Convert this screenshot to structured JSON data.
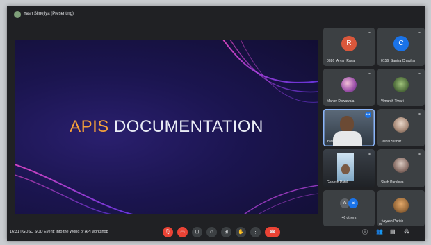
{
  "header": {
    "presenting_label": "Yash Simejiya (Presenting)"
  },
  "slide": {
    "title_part1": "APIS",
    "title_part2": "DOCUMENTATION"
  },
  "participants": [
    {
      "name": "0026_Aryan Raval",
      "initial": "R",
      "avatar_color": "#d9573b",
      "type": "initial"
    },
    {
      "name": "0156_Saniya Chauhan",
      "initial": "C",
      "avatar_color": "#1a73e8",
      "type": "initial"
    },
    {
      "name": "Manav Dawawala",
      "type": "photo"
    },
    {
      "name": "Vimarsh Tiwari",
      "type": "photo"
    },
    {
      "name": "Yash Simejiya",
      "type": "video"
    },
    {
      "name": "Jainal Suthar",
      "type": "photo"
    },
    {
      "name": "Ganesh Patel",
      "type": "video"
    },
    {
      "name": "Shah Parshwa",
      "type": "photo"
    },
    {
      "name": "46 others",
      "initials": [
        "A",
        "S"
      ],
      "type": "others"
    },
    {
      "name": "Aayush Parikh",
      "type": "photo"
    }
  ],
  "footer": {
    "time": "16:31",
    "separator": "|",
    "meeting_title": "GDSC SOU Event: Into the World of API workshop",
    "participants_count": "56"
  },
  "controls": {
    "mic": "mic-off-icon",
    "camera": "camera-off-icon",
    "captions": "captions-icon",
    "reactions": "emoji-icon",
    "present": "present-icon",
    "raise_hand": "hand-icon",
    "more": "more-vert-icon",
    "leave": "call-end-icon"
  },
  "colors": {
    "end_call": "#ea4335",
    "brand_orange": "#f5a03a",
    "meet_bg": "#202124"
  }
}
